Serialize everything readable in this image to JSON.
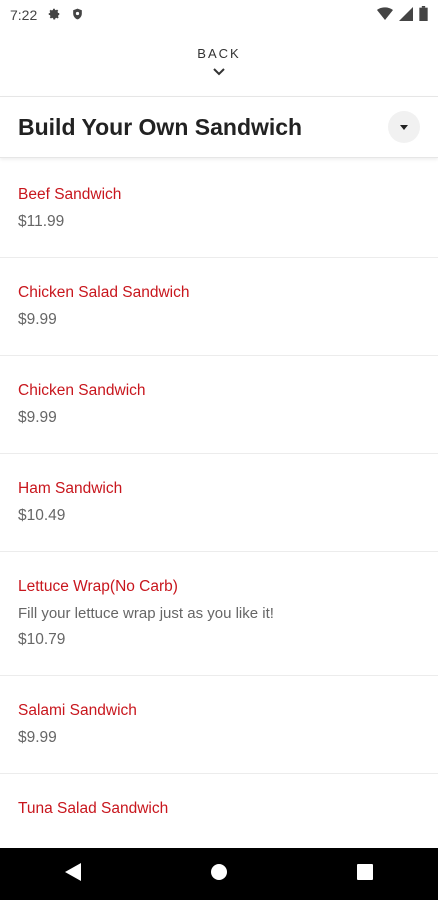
{
  "status_bar": {
    "time": "7:22"
  },
  "back": {
    "label": "BACK"
  },
  "header": {
    "title": "Build Your Own Sandwich"
  },
  "items": [
    {
      "name": "Beef Sandwich",
      "description": "",
      "price": "$11.99"
    },
    {
      "name": "Chicken Salad Sandwich",
      "description": "",
      "price": "$9.99"
    },
    {
      "name": "Chicken Sandwich",
      "description": "",
      "price": "$9.99"
    },
    {
      "name": "Ham Sandwich",
      "description": "",
      "price": "$10.49"
    },
    {
      "name": "Lettuce Wrap(No Carb)",
      "description": "Fill your lettuce wrap just as you like it!",
      "price": "$10.79"
    },
    {
      "name": "Salami Sandwich",
      "description": "",
      "price": "$9.99"
    },
    {
      "name": "Tuna Salad Sandwich",
      "description": "",
      "price": ""
    }
  ],
  "colors": {
    "accent": "#c8161d",
    "nav_bar": "#000000"
  },
  "icons": [
    "gear-icon",
    "shield-icon",
    "wifi-icon",
    "signal-icon",
    "battery-icon",
    "chevron-down-icon",
    "caret-down-icon",
    "nav-back-icon",
    "nav-home-icon",
    "nav-recents-icon"
  ]
}
